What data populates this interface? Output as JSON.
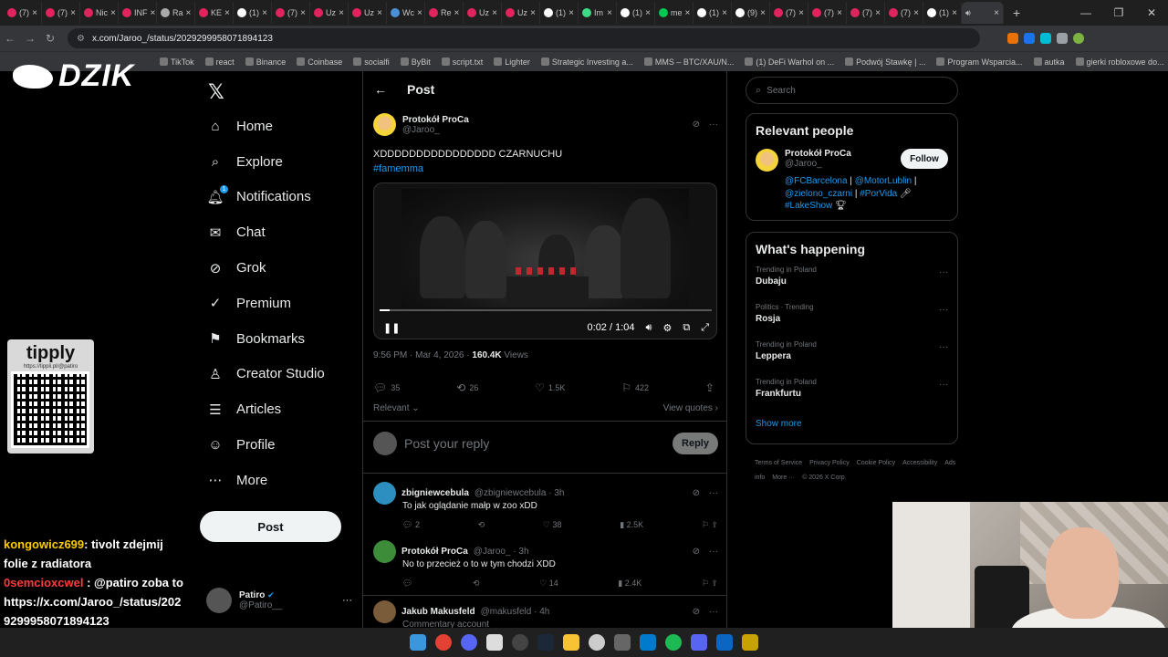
{
  "browser": {
    "tabs": [
      {
        "label": "(7)",
        "color": "#e0245e"
      },
      {
        "label": "(7)",
        "color": "#e0245e"
      },
      {
        "label": "Nic",
        "color": "#e0245e"
      },
      {
        "label": "INF",
        "color": "#e0245e"
      },
      {
        "label": "Ra",
        "color": "#aaaaaa"
      },
      {
        "label": "KE",
        "color": "#e0245e"
      },
      {
        "label": "(1)",
        "color": "#ffffff"
      },
      {
        "label": "(7)",
        "color": "#e0245e"
      },
      {
        "label": "Uz",
        "color": "#e0245e"
      },
      {
        "label": "Uz",
        "color": "#e0245e"
      },
      {
        "label": "Wc",
        "color": "#4a90d9"
      },
      {
        "label": "Re",
        "color": "#e0245e"
      },
      {
        "label": "Uz",
        "color": "#e0245e"
      },
      {
        "label": "Uz",
        "color": "#e0245e"
      },
      {
        "label": "(1)",
        "color": "#ffffff"
      },
      {
        "label": "Im",
        "color": "#3ddc84"
      },
      {
        "label": "(1)",
        "color": "#ffffff"
      },
      {
        "label": "me",
        "color": "#00c853"
      },
      {
        "label": "(1)",
        "color": "#ffffff"
      },
      {
        "label": "(9)",
        "color": "#ffffff"
      },
      {
        "label": "(7)",
        "color": "#e0245e"
      },
      {
        "label": "(7)",
        "color": "#e0245e"
      },
      {
        "label": "(7)",
        "color": "#e0245e"
      },
      {
        "label": "(7)",
        "color": "#e0245e"
      },
      {
        "label": "(1)",
        "color": "#ffffff"
      }
    ],
    "url": "x.com/Jaroo_/status/2029299958071894123",
    "bookmarks": [
      "TikTok",
      "react",
      "Binance",
      "Coinbase",
      "socialfi",
      "ByBit",
      "script.txt",
      "Lighter",
      "Strategic Investing a...",
      "MMS – BTC/XAU/N...",
      "(1) DeFi Warhol on ...",
      "Podwój Stawkę | ...",
      "Program Wsparcia...",
      "autka",
      "gierki robloxowe do..."
    ]
  },
  "overlay": {
    "brand": "DZIK",
    "tippy_logo": "tipply",
    "tippy_url": "https://tippli.pl/@patiro",
    "chat": [
      {
        "user": "kongowicz699",
        "sep": ": ",
        "msg": "tivolt zdejmij folie z radiatora"
      },
      {
        "user": "0semcioxcwel",
        "sep": " : ",
        "msg": "@patiro zoba to"
      },
      {
        "user": "",
        "sep": "",
        "msg": "https://x.com/Jaroo_/status/2029299958071894123"
      }
    ]
  },
  "nav": {
    "items": [
      {
        "label": "Home",
        "icon": "⌂"
      },
      {
        "label": "Explore",
        "icon": "⌕"
      },
      {
        "label": "Notifications",
        "icon": "🔔︎"
      },
      {
        "label": "Chat",
        "icon": "✉"
      },
      {
        "label": "Grok",
        "icon": "⊘"
      },
      {
        "label": "Premium",
        "icon": "✓"
      },
      {
        "label": "Bookmarks",
        "icon": "⚑"
      },
      {
        "label": "Creator Studio",
        "icon": "♙"
      },
      {
        "label": "Articles",
        "icon": "☰"
      },
      {
        "label": "Profile",
        "icon": "☺"
      },
      {
        "label": "More",
        "icon": "⋯"
      }
    ],
    "notif_badge": "1",
    "post_button": "Post",
    "account": {
      "name": "Patiro",
      "handle": "@Patiro__"
    }
  },
  "post": {
    "header_title": "Post",
    "author_name": "Protokół ProCa",
    "author_handle": "@Jaroo_",
    "text": "XDDDDDDDDDDDDDDDD CZARNUCHU",
    "hashtag": "#famemma",
    "video": {
      "time": "0:02 / 1:04",
      "progress": 0.03
    },
    "time": "9:56 PM · Mar 4, 2026 · ",
    "views_count": "160.4K",
    "views_label": " Views",
    "replies": "35",
    "reposts": "26",
    "likes": "1.5K",
    "bookmarks": "422",
    "sort_label": "Relevant",
    "view_quotes": "View quotes",
    "reply_placeholder": "Post your reply",
    "reply_button": "Reply"
  },
  "replies": [
    {
      "name": "zbigniewcebula",
      "handle": "@zbigniewcebula · 3h",
      "text": "To jak oglądanie małp w zoo xDD",
      "replies": "2",
      "reposts": "",
      "likes": "38",
      "views": "2.5K",
      "avatar_color": "#2c8fbf"
    },
    {
      "name": "Protokół ProCa",
      "handle": "@Jaroo_ · 3h",
      "text": "No to przecież o to w tym chodzi XDD",
      "replies": "",
      "reposts": "",
      "likes": "14",
      "views": "2.4K",
      "avatar_color": "#f5d33a"
    },
    {
      "name": "Jakub Makusfeld",
      "handle": "@makusfeld · 4h",
      "text": "Commentary account",
      "avatar_color": "#7a5c3a"
    }
  ],
  "sidebar": {
    "search_placeholder": "Search",
    "relevant_title": "Relevant people",
    "person_name": "Protokół ProCa",
    "person_handle": "@Jaroo_",
    "follow": "Follow",
    "bio": {
      "l1a": "@FCBarcelona",
      "l1b": "@MotorLublin",
      "l2a": "@zielono_czarni",
      "l2b": "#PorVida",
      "l3": "#LakeShow"
    },
    "happening_title": "What's happening",
    "trends": [
      {
        "context": "Trending in Poland",
        "name": "Dubaju"
      },
      {
        "context": "Politics · Trending",
        "name": "Rosja"
      },
      {
        "context": "Trending in Poland",
        "name": "Leppera"
      },
      {
        "context": "Trending in Poland",
        "name": "Frankfurtu"
      }
    ],
    "show_more": "Show more",
    "footer": [
      "Terms of Service",
      "Privacy Policy",
      "Cookie Policy",
      "Accessibility",
      "Ads info",
      "More ···",
      "© 2026 X Corp."
    ]
  }
}
